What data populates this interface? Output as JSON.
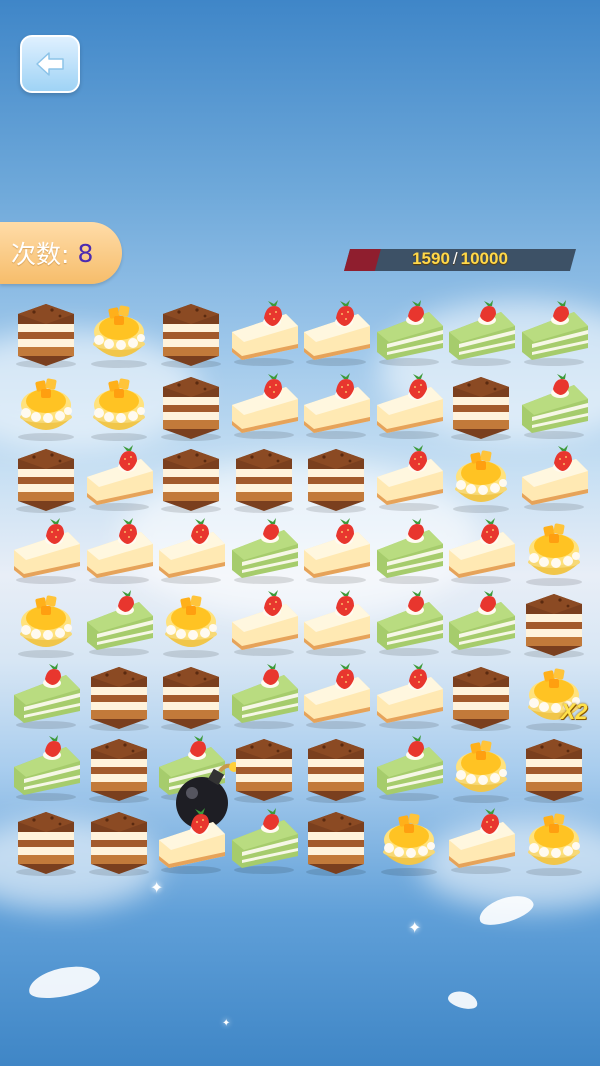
{
  "back_button": {
    "icon": "arrow-left-icon"
  },
  "moves": {
    "label": "次数:",
    "value": "8"
  },
  "score": {
    "current": "1590",
    "target": "10000",
    "progress": 0.159
  },
  "board": {
    "rows": 8,
    "cols": 8,
    "cells": [
      [
        "tiramisu",
        "mango-dessert",
        "tiramisu",
        "cheesecake",
        "cheesecake",
        "matcha-cake",
        "matcha-cake",
        "matcha-cake"
      ],
      [
        "mango-dessert",
        "mango-dessert",
        "tiramisu",
        "cheesecake",
        "cheesecake",
        "cheesecake",
        "tiramisu",
        "matcha-cake"
      ],
      [
        "tiramisu",
        "cheesecake",
        "tiramisu",
        "tiramisu",
        "tiramisu",
        "cheesecake",
        "mango-dessert",
        "cheesecake"
      ],
      [
        "cheesecake",
        "cheesecake",
        "cheesecake",
        "matcha-cake",
        "cheesecake",
        "matcha-cake",
        "cheesecake",
        "mango-dessert"
      ],
      [
        "mango-dessert",
        "matcha-cake",
        "mango-dessert",
        "cheesecake",
        "cheesecake",
        "matcha-cake",
        "matcha-cake",
        "tiramisu"
      ],
      [
        "matcha-cake",
        "tiramisu",
        "tiramisu",
        "matcha-cake",
        "cheesecake",
        "cheesecake",
        "tiramisu",
        "mango-dessert"
      ],
      [
        "matcha-cake",
        "tiramisu",
        "matcha-cake",
        "tiramisu",
        "tiramisu",
        "matcha-cake",
        "mango-dessert",
        "tiramisu"
      ],
      [
        "tiramisu",
        "tiramisu",
        "cheesecake",
        "matcha-cake",
        "tiramisu",
        "mango-dessert",
        "cheesecake",
        "mango-dessert"
      ]
    ],
    "specials": [
      {
        "row": 6,
        "col": 2,
        "type": "bomb-icon"
      },
      {
        "row": 5,
        "col": 7,
        "type": "multiplier",
        "label": "X2"
      }
    ]
  },
  "colors": {
    "moves_value": "#4c2bb0",
    "score_text": "#ffd84a",
    "progress_fill": "#8f1e2e"
  }
}
